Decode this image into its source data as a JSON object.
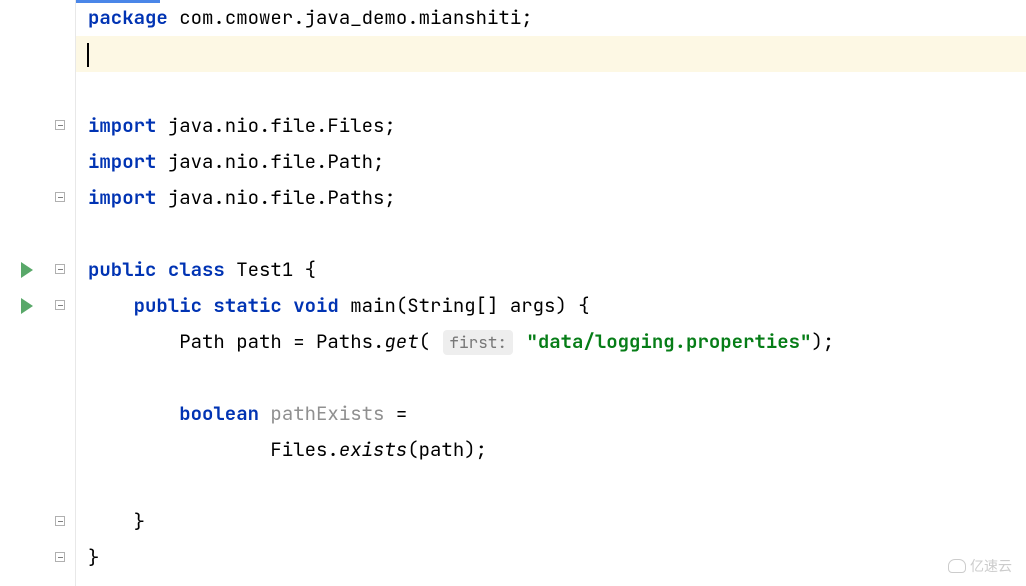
{
  "code": {
    "package_kw": "package",
    "package_name": " com.cmower.java_demo.mianshiti;",
    "import_kw": "import",
    "import1": " java.nio.file.Files;",
    "import2": " java.nio.file.Path;",
    "import3": " java.nio.file.Paths;",
    "public_kw": "public",
    "class_kw": "class",
    "static_kw": "static",
    "void_kw": "void",
    "boolean_kw": "boolean",
    "class_name": " Test1 ",
    "main_sig": " main(String[] args) ",
    "path_decl": "        Path path = Paths.",
    "get_method": "get",
    "param_hint": "first:",
    "string_literal": "\"data/logging.properties\"",
    "get_close": ");",
    "pathExists_var": " pathExists",
    "pathExists_eq": " =",
    "files_call": "                Files.",
    "exists_method": "exists",
    "exists_args": "(path);",
    "open_brace": "{",
    "close_brace": "}",
    "indent1": "    ",
    "indent2": "        "
  },
  "watermark": {
    "text": "亿速云"
  }
}
